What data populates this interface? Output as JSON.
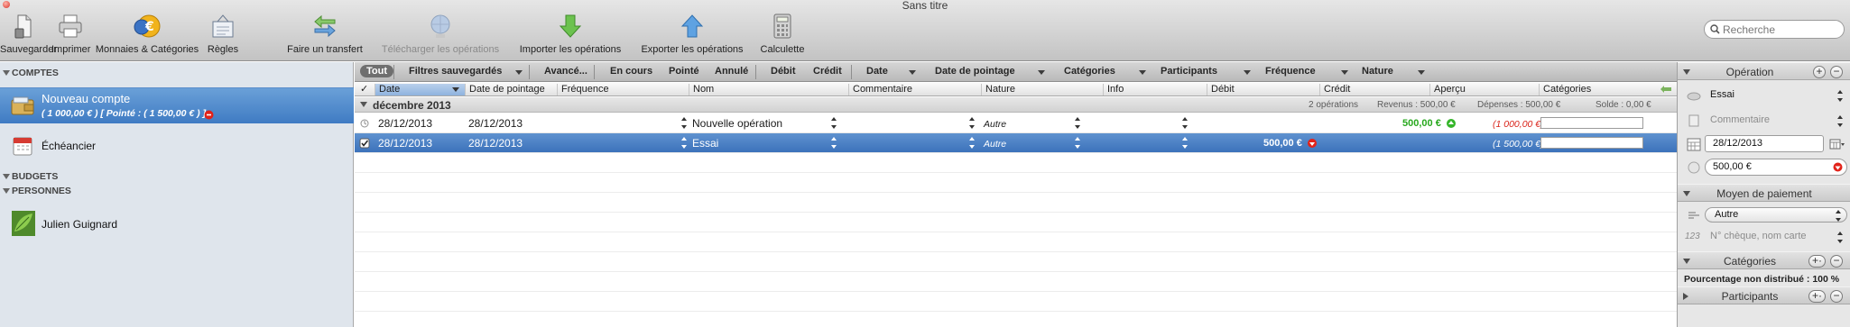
{
  "window": {
    "title": "Sans titre"
  },
  "toolbar": [
    {
      "label": "Sauvegarder",
      "icon": "save-icon",
      "enabled": true
    },
    {
      "label": "Imprimer",
      "icon": "print-icon",
      "enabled": true
    },
    {
      "label": "Monnaies & Catégories",
      "icon": "currencies-icon",
      "enabled": true
    },
    {
      "label": "Règles",
      "icon": "rules-icon",
      "enabled": true
    },
    {
      "label": "Faire un transfert",
      "icon": "transfer-icon",
      "enabled": true
    },
    {
      "label": "Télécharger les opérations",
      "icon": "download-globe-icon",
      "enabled": false
    },
    {
      "label": "Importer les opérations",
      "icon": "import-arrow-icon",
      "enabled": true
    },
    {
      "label": "Exporter les opérations",
      "icon": "export-arrow-icon",
      "enabled": true
    },
    {
      "label": "Calculette",
      "icon": "calculator-icon",
      "enabled": true
    }
  ],
  "search": {
    "placeholder": "Recherche"
  },
  "sidebar": {
    "comptes_header": "COMPTES",
    "account": {
      "name": "Nouveau compte",
      "summary": "( 1 000,00 € ) [ Pointé : ( 1 500,00 € ) ]"
    },
    "echeancier": "Échéancier",
    "budgets_header": "BUDGETS",
    "personnes_header": "PERSONNES",
    "person": "Julien Guignard"
  },
  "filters": {
    "tout": "Tout",
    "filtres": "Filtres sauvegardés",
    "avance": "Avancé...",
    "en_cours": "En cours",
    "pointe": "Pointé",
    "annule": "Annulé",
    "debit": "Débit",
    "credit": "Crédit",
    "date": "Date",
    "date_pointage": "Date de pointage",
    "categories": "Catégories",
    "participants": "Participants",
    "frequence": "Fréquence",
    "nature": "Nature"
  },
  "table": {
    "columns": {
      "check": "✓",
      "date": "Date",
      "date_pointage": "Date de pointage",
      "frequence": "Fréquence",
      "nom": "Nom",
      "commentaire": "Commentaire",
      "nature": "Nature",
      "info": "Info",
      "debit": "Débit",
      "credit": "Crédit",
      "apercu": "Aperçu",
      "categories": "Catégories"
    },
    "group": {
      "name": "décembre 2013",
      "count": "2 opérations",
      "revenus": "Revenus : 500,00 €",
      "depenses": "Dépenses : 500,00 €",
      "solde": "Solde : 0,00 €"
    },
    "rows": [
      {
        "date": "28/12/2013",
        "date_pointage": "28/12/2013",
        "nom": "Nouvelle opération",
        "nature": "Autre",
        "debit": "",
        "credit": "500,00 €",
        "solde": "(1 000,00 €)",
        "selected": false,
        "checked": false
      },
      {
        "date": "28/12/2013",
        "date_pointage": "28/12/2013",
        "nom": "Essai",
        "nature": "Autre",
        "debit": "500,00 €",
        "credit": "",
        "solde": "(1 500,00 €)",
        "selected": true,
        "checked": true
      }
    ]
  },
  "inspector": {
    "operation_header": "Opération",
    "name_value": "Essai",
    "comment_placeholder": "Commentaire",
    "date_value": "28/12/2013",
    "amount_value": "500,00 €",
    "moyen_header": "Moyen de paiement",
    "moyen_value": "Autre",
    "cheque_placeholder": "N° chèque, nom carte",
    "categories_header": "Catégories",
    "pourcentage": "Pourcentage non distribué : 100 %",
    "participants_header": "Participants"
  },
  "colors": {
    "selection": "#3f7bc3",
    "credit_green": "#27a81d",
    "debit_red": "#d9241b"
  }
}
